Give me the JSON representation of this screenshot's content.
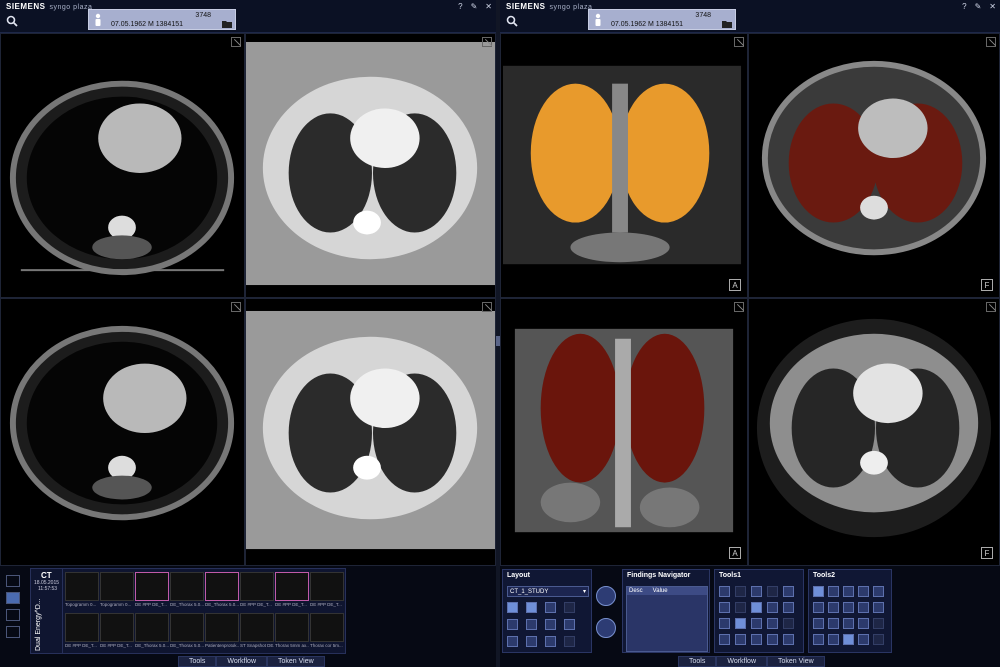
{
  "left_window": {
    "brand": "SIEMENS",
    "app_name": "syngo plaza",
    "patient": {
      "id": "3748",
      "demographics": "07.05.1962  M  1384151"
    },
    "top_icons": [
      "?",
      "✎",
      "✕"
    ]
  },
  "right_window": {
    "brand": "SIEMENS",
    "app_name": "syngo plaza",
    "patient": {
      "id": "3748",
      "demographics": "07.05.1962  M  1384151"
    },
    "top_icons": [
      "?",
      "✎",
      "✕"
    ]
  },
  "viewports": {
    "top_right_orient": "A",
    "bottom_right_orient": "A",
    "topright_right_orient": "F",
    "bottomright_right_orient": "F"
  },
  "series_panel": {
    "modality": "CT",
    "date": "18.05.2015",
    "time": "11:57:53",
    "vertical_label": "Dual Energy^D...",
    "thumbnails": [
      {
        "caption": "Topogramm 0...",
        "selected": false
      },
      {
        "caption": "Topogramm 0...",
        "selected": false
      },
      {
        "caption": "DE #PP DE_T...",
        "selected": true
      },
      {
        "caption": "DE_Thorax 5.0...",
        "selected": false
      },
      {
        "caption": "DE_Thorax 5.0...",
        "selected": true
      },
      {
        "caption": "DE #PP DE_T...",
        "selected": false
      },
      {
        "caption": "DE #PP DE_T...",
        "selected": true
      },
      {
        "caption": "DE #PP DE_T...",
        "selected": false
      },
      {
        "caption": "DE #PP DE_T...",
        "selected": false
      },
      {
        "caption": "DE #PP DE_T...",
        "selected": false
      },
      {
        "caption": "DE_Thorax 5.0...",
        "selected": false
      },
      {
        "caption": "DE_Thorax 5.0...",
        "selected": false
      },
      {
        "caption": "Patientenprotok...",
        "selected": false
      },
      {
        "caption": "ST Snapshot DE...",
        "selected": false
      },
      {
        "caption": "Thorax 5mm ax...",
        "selected": false
      },
      {
        "caption": "Thorax cor 5m...",
        "selected": false
      }
    ]
  },
  "tabs_left": [
    "Tools",
    "Workflow",
    "Token View"
  ],
  "tabs_right": [
    "Tools",
    "Workflow",
    "Token View"
  ],
  "layout_panel": {
    "title": "Layout",
    "selected": "CT_1_STUDY"
  },
  "findings_panel": {
    "title": "Findings Navigator",
    "col_desc": "Desc",
    "col_value": "Value"
  },
  "tools1_panel": {
    "title": "Tools1"
  },
  "tools2_panel": {
    "title": "Tools2"
  }
}
